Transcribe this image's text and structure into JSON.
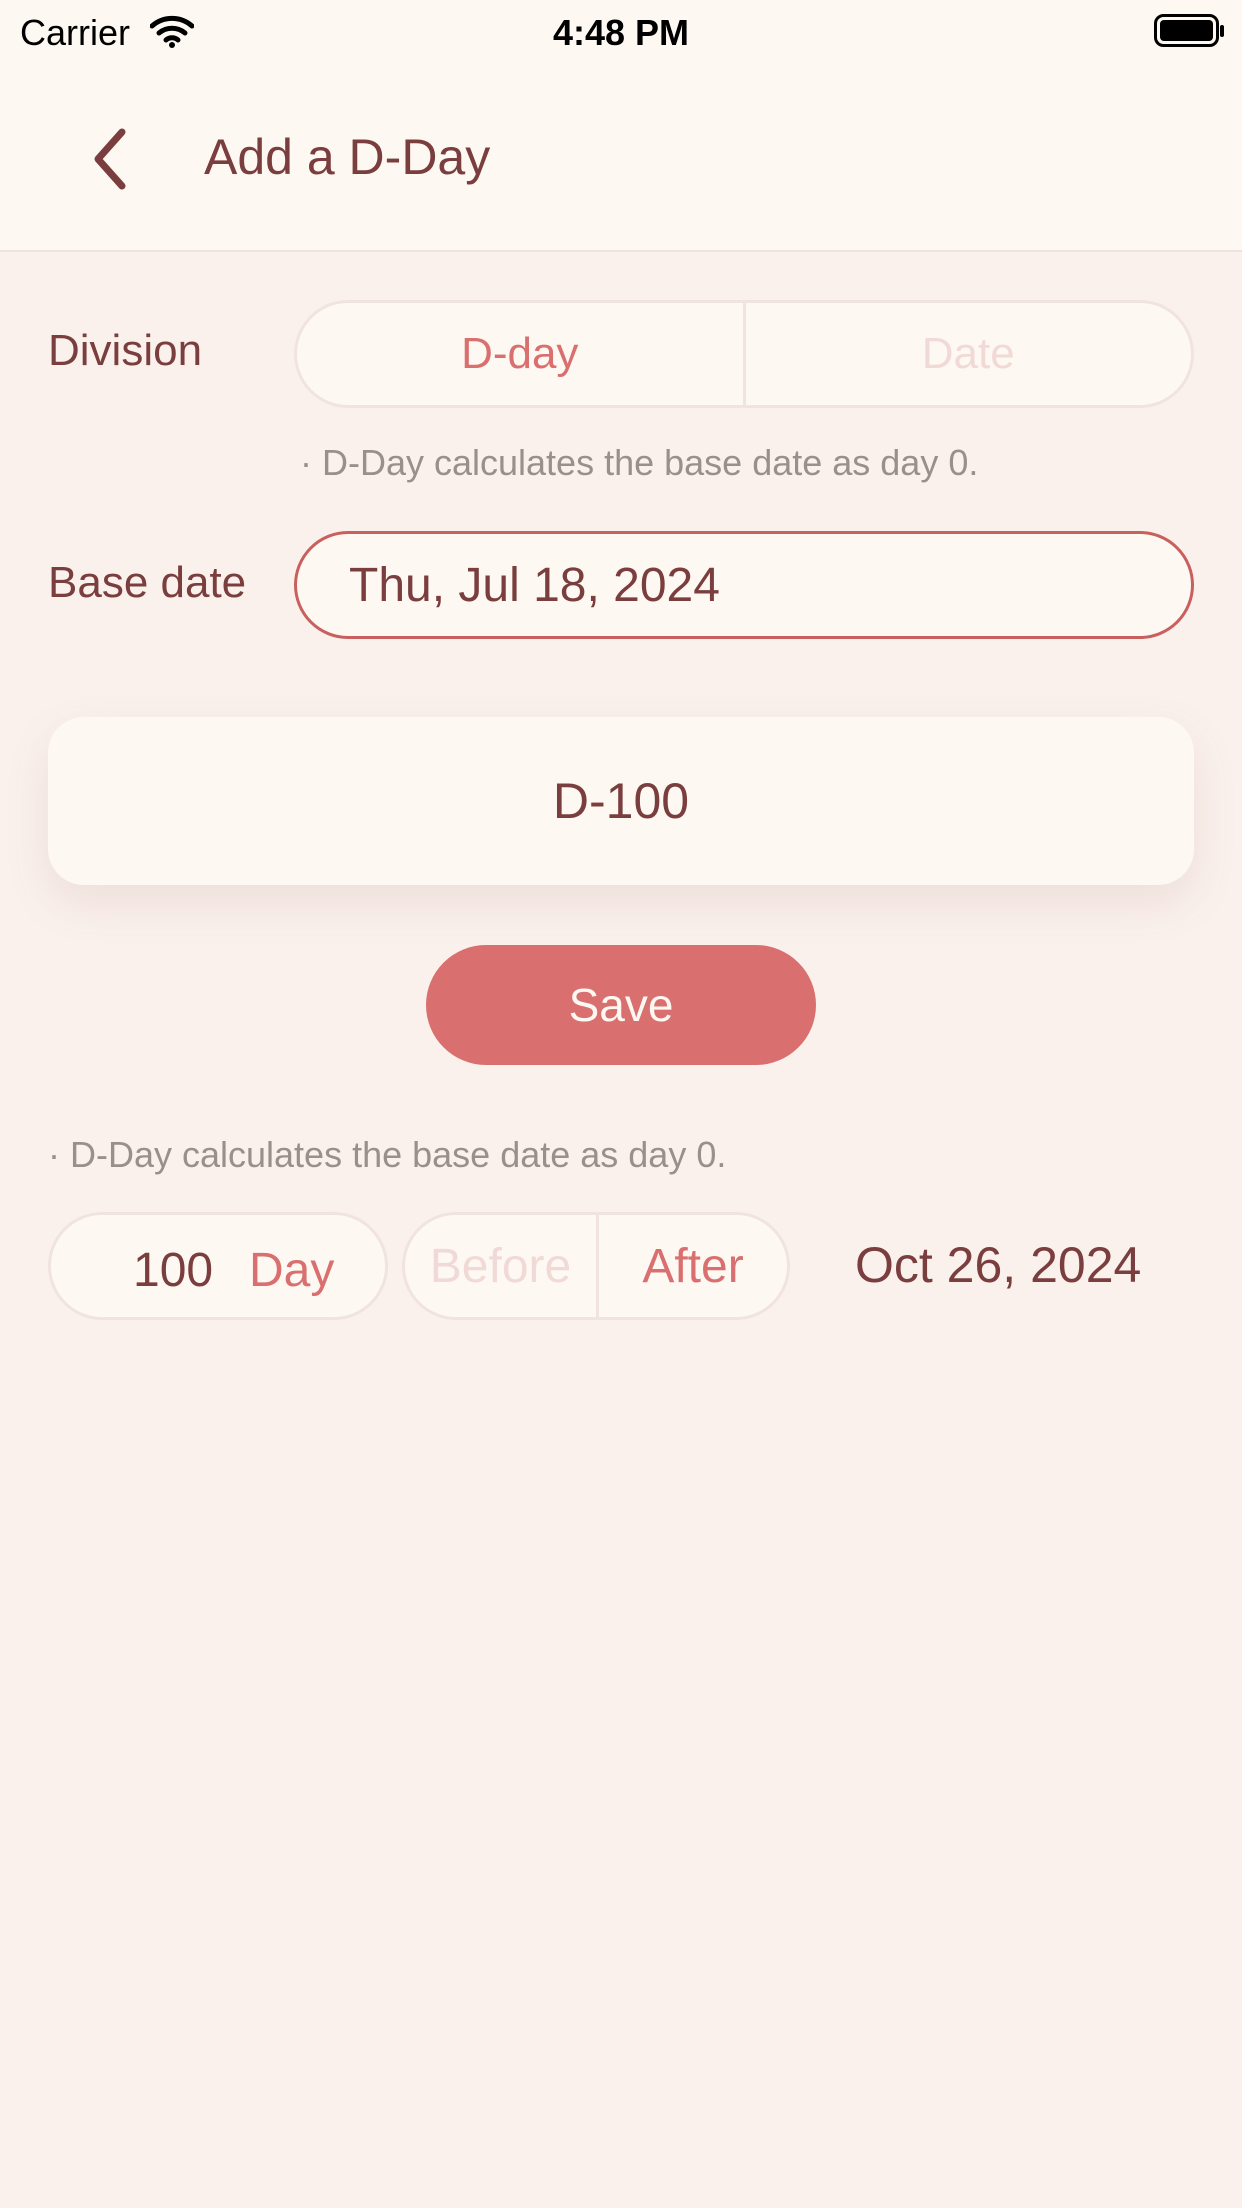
{
  "status_bar": {
    "carrier": "Carrier",
    "time": "4:48 PM"
  },
  "nav": {
    "title": "Add a D-Day",
    "back_icon": "chevron-left-icon"
  },
  "division": {
    "label": "Division",
    "options": [
      "D-day",
      "Date"
    ],
    "selected": "D-day"
  },
  "hint_top": "· D-Day calculates the base date as day 0.",
  "base_date": {
    "label": "Base date",
    "value": "Thu, Jul 18, 2024"
  },
  "result": "D-100",
  "save_label": "Save",
  "hint_bottom": "· D-Day calculates the base date as day 0.",
  "calculator": {
    "count": "100",
    "unit": "Day",
    "directions": [
      "Before",
      "After"
    ],
    "selected_direction": "After",
    "computed_date": "Oct 26, 2024"
  },
  "colors": {
    "background": "#FAF1EC",
    "surface": "#FEF8F3",
    "accent": "#D9706F",
    "text": "#7A3E3E",
    "muted_text": "#9A8F8D",
    "inactive": "#F1DAD6"
  }
}
